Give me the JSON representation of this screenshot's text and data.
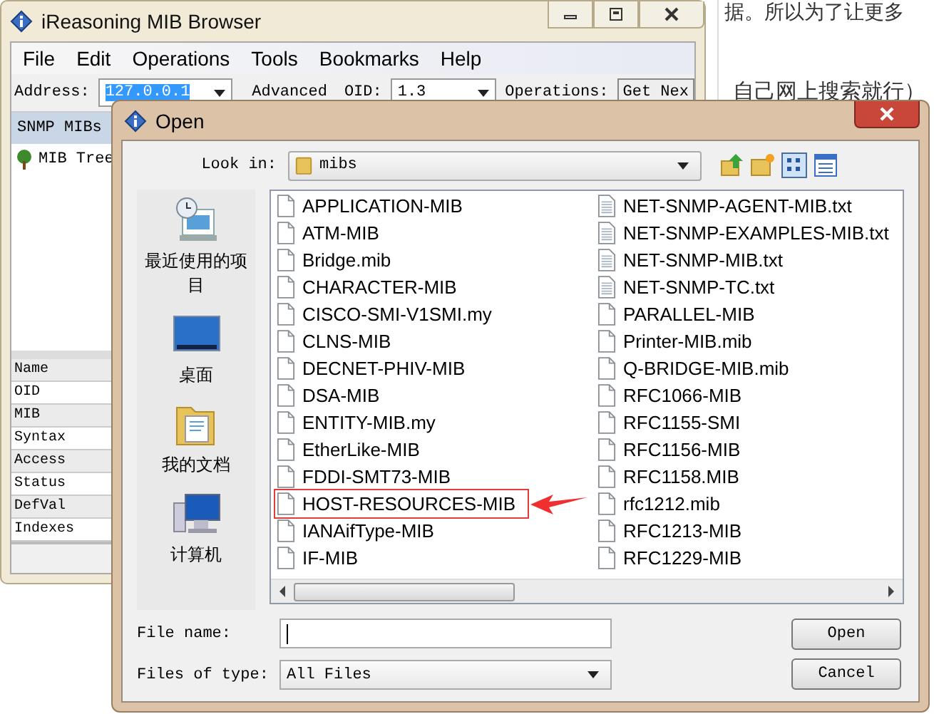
{
  "background_text": [
    "据。所以为了让更多",
    "自己网上搜索就行）"
  ],
  "main_window": {
    "title": "iReasoning MIB Browser",
    "menu": [
      "File",
      "Edit",
      "Operations",
      "Tools",
      "Bookmarks",
      "Help"
    ],
    "toolbar": {
      "address_label": "Address:",
      "address_value": "127.0.0.1",
      "advanced_label": "Advanced",
      "oid_label": "OID:",
      "oid_value": "1.3",
      "operations_label": "Operations:",
      "go_button": "Get Nex"
    },
    "sidebar_tab": "SNMP MIBs",
    "tree": [
      {
        "label": "MIB Tree"
      }
    ],
    "properties": [
      "Name",
      "OID",
      "MIB",
      "Syntax",
      "Access",
      "Status",
      "DefVal",
      "Indexes"
    ]
  },
  "dialog": {
    "title": "Open",
    "look_in_label": "Look in:",
    "look_in_value": "mibs",
    "places": [
      {
        "label": "最近使用的项目",
        "kind": "recent"
      },
      {
        "label": "桌面",
        "kind": "desktop"
      },
      {
        "label": "我的文档",
        "kind": "documents"
      },
      {
        "label": "计算机",
        "kind": "computer"
      }
    ],
    "files": [
      {
        "name": "APPLICATION-MIB",
        "kind": "file",
        "highlighted": false
      },
      {
        "name": "ATM-MIB",
        "kind": "file",
        "highlighted": false
      },
      {
        "name": "Bridge.mib",
        "kind": "file",
        "highlighted": false
      },
      {
        "name": "CHARACTER-MIB",
        "kind": "file",
        "highlighted": false
      },
      {
        "name": "CISCO-SMI-V1SMI.my",
        "kind": "file",
        "highlighted": false
      },
      {
        "name": "CLNS-MIB",
        "kind": "file",
        "highlighted": false
      },
      {
        "name": "DECNET-PHIV-MIB",
        "kind": "file",
        "highlighted": false
      },
      {
        "name": "DSA-MIB",
        "kind": "file",
        "highlighted": false
      },
      {
        "name": "ENTITY-MIB.my",
        "kind": "file",
        "highlighted": false
      },
      {
        "name": "EtherLike-MIB",
        "kind": "file",
        "highlighted": false
      },
      {
        "name": "FDDI-SMT73-MIB",
        "kind": "file",
        "highlighted": false
      },
      {
        "name": "HOST-RESOURCES-MIB",
        "kind": "file",
        "highlighted": true
      },
      {
        "name": "IANAifType-MIB",
        "kind": "file",
        "highlighted": false
      },
      {
        "name": "IF-MIB",
        "kind": "file",
        "highlighted": false
      },
      {
        "name": "NET-SNMP-AGENT-MIB.txt",
        "kind": "text",
        "highlighted": false
      },
      {
        "name": "NET-SNMP-EXAMPLES-MIB.txt",
        "kind": "text",
        "highlighted": false
      },
      {
        "name": "NET-SNMP-MIB.txt",
        "kind": "text",
        "highlighted": false
      },
      {
        "name": "NET-SNMP-TC.txt",
        "kind": "text",
        "highlighted": false
      },
      {
        "name": "PARALLEL-MIB",
        "kind": "file",
        "highlighted": false
      },
      {
        "name": "Printer-MIB.mib",
        "kind": "file",
        "highlighted": false
      },
      {
        "name": "Q-BRIDGE-MIB.mib",
        "kind": "file",
        "highlighted": false
      },
      {
        "name": "RFC1066-MIB",
        "kind": "file",
        "highlighted": false
      },
      {
        "name": "RFC1155-SMI",
        "kind": "file",
        "highlighted": false
      },
      {
        "name": "RFC1156-MIB",
        "kind": "file",
        "highlighted": false
      },
      {
        "name": "RFC1158.MIB",
        "kind": "file",
        "highlighted": false
      },
      {
        "name": "rfc1212.mib",
        "kind": "file",
        "highlighted": false
      },
      {
        "name": "RFC1213-MIB",
        "kind": "file",
        "highlighted": false
      },
      {
        "name": "RFC1229-MIB",
        "kind": "file",
        "highlighted": false
      }
    ],
    "file_name_label": "File name:",
    "files_of_type_label": "Files of type:",
    "files_of_type_value": "All Files",
    "buttons": [
      "Open",
      "Cancel"
    ]
  }
}
